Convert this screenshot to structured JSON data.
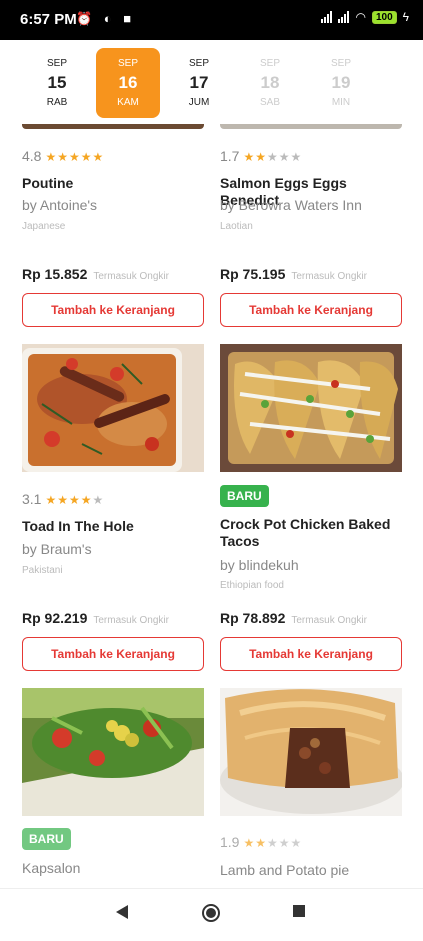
{
  "status": {
    "time": "6:57 PM",
    "battery": "100"
  },
  "dates": [
    {
      "month": "SEP",
      "day": "15",
      "weekday": "RAB"
    },
    {
      "month": "SEP",
      "day": "16",
      "weekday": "KAM"
    },
    {
      "month": "SEP",
      "day": "17",
      "weekday": "JUM"
    },
    {
      "month": "SEP",
      "day": "18",
      "weekday": "SAB"
    },
    {
      "month": "SEP",
      "day": "19",
      "weekday": "MIN"
    }
  ],
  "cards": [
    {
      "rating": "4.8",
      "stars": 5,
      "title": "Poutine",
      "by": "by Antoine's",
      "category": "Japanese",
      "price": "Rp 15.852",
      "note": "Termasuk Ongkir",
      "button": "Tambah ke Keranjang"
    },
    {
      "rating": "1.7",
      "stars": 2,
      "title": "Salmon Eggs Eggs Benedict",
      "by": "by Berowra Waters Inn",
      "category": "Laotian",
      "price": "Rp 75.195",
      "note": "Termasuk Ongkir",
      "button": "Tambah ke Keranjang"
    },
    {
      "rating": "3.1",
      "stars": 3,
      "title": "Toad In The Hole",
      "by": "by Braum's",
      "category": "Pakistani",
      "price": "Rp 92.219",
      "note": "Termasuk Ongkir",
      "button": "Tambah ke Keranjang"
    },
    {
      "badge": "BARU",
      "title": "Crock Pot Chicken Baked Tacos",
      "by": "by blindekuh",
      "category": "Ethiopian food",
      "price": "Rp 78.892",
      "note": "Termasuk Ongkir",
      "button": "Tambah ke Keranjang"
    },
    {
      "badge": "BARU",
      "title": "Kapsalon"
    },
    {
      "rating": "1.9",
      "stars": 2,
      "title": "Lamb and Potato pie"
    }
  ],
  "colors": {
    "accent": "#f7941d",
    "button": "#e53935",
    "badge": "#37b24d",
    "star": "#f5a623"
  }
}
